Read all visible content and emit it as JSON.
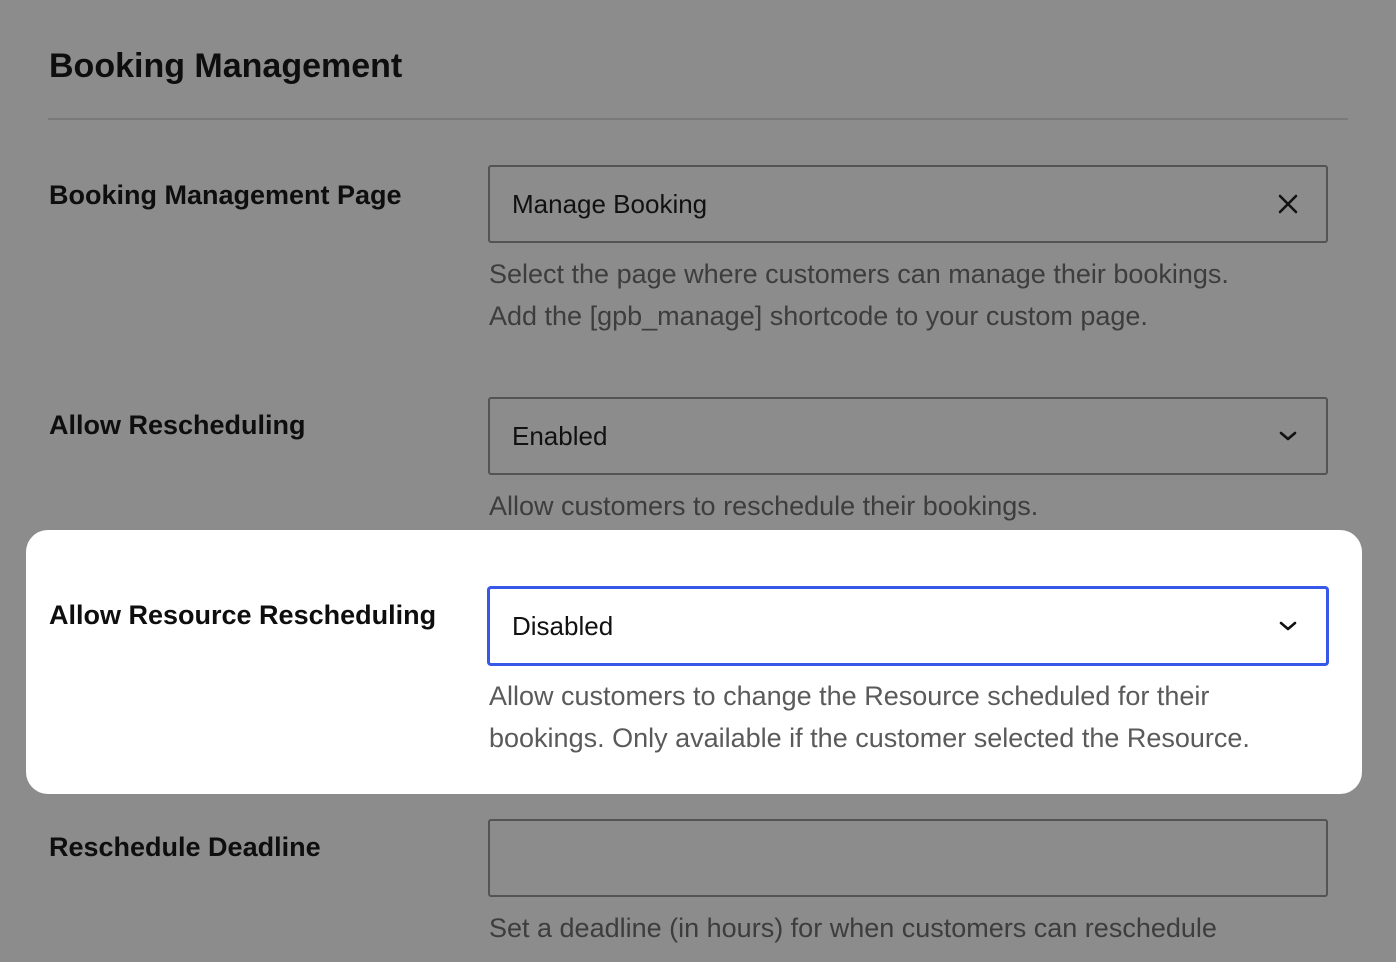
{
  "section": {
    "title": "Booking Management"
  },
  "management_page": {
    "label": "Booking Management Page",
    "value": "Manage Booking",
    "clear_icon": "close-icon",
    "help": [
      "Select the page where customers can manage their bookings.",
      "Add the [gpb_manage] shortcode to your custom page."
    ]
  },
  "allow_rescheduling": {
    "label": "Allow Rescheduling",
    "value": "Enabled",
    "dropdown_icon": "chevron-down-icon",
    "help": [
      "Allow customers to reschedule their bookings."
    ]
  },
  "allow_resource_rescheduling": {
    "label": "Allow Resource Rescheduling",
    "value": "Disabled",
    "dropdown_icon": "chevron-down-icon",
    "help": [
      "Allow customers to change the Resource scheduled for their",
      "bookings. Only available if the customer selected the Resource."
    ]
  },
  "reschedule_deadline": {
    "label": "Reschedule Deadline",
    "value": "",
    "help": [
      "Set a deadline (in hours) for when customers can reschedule"
    ]
  },
  "colors": {
    "overlay_background": "#8c8c8c",
    "highlight_card": "#ffffff",
    "focus_border": "#3858e9"
  }
}
